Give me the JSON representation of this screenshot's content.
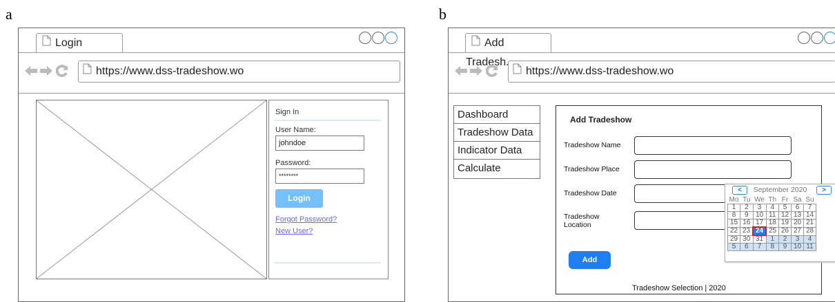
{
  "panel_a": {
    "letter": "a",
    "tab_title": "Login",
    "url": "https://www.dss-tradeshow.wo",
    "signin": {
      "heading": "Sign In",
      "username_label": "User Name:",
      "username_value": "johndoe",
      "password_label": "Password:",
      "password_value": "********",
      "login_button": "Login",
      "forgot_link": "Forgot Password?",
      "new_user_link": "New User?"
    }
  },
  "panel_b": {
    "letter": "b",
    "tab_title": "Add Tradesh..",
    "url": "https://www.dss-tradeshow.wo",
    "menu": [
      "Dashboard",
      "Tradeshow Data",
      "Indicator Data",
      "Calculate"
    ],
    "form": {
      "title": "Add Tradeshow",
      "name_label": "Tradeshow Name",
      "place_label": "Tradeshow Place",
      "date_label": "Tradeshow Date",
      "location_label_1": "Tradeshow",
      "location_label_2": "Location",
      "add_button": "Add"
    },
    "calendar": {
      "month_label": "September 2020",
      "prev": "<",
      "next": ">",
      "weekdays": [
        "Mo",
        "Tu",
        "We",
        "Th",
        "Fr",
        "Sa",
        "Su"
      ],
      "weeks": [
        [
          "1",
          "2",
          "3",
          "4",
          "5",
          "6",
          "7"
        ],
        [
          "8",
          "9",
          "10",
          "11",
          "12",
          "13",
          "14"
        ],
        [
          "15",
          "16",
          "17",
          "18",
          "19",
          "20",
          "21"
        ],
        [
          "22",
          "23",
          "24",
          "25",
          "26",
          "27",
          "28"
        ],
        [
          "29",
          "30",
          "31",
          "1",
          "2",
          "3",
          "4"
        ],
        [
          "5",
          "6",
          "7",
          "8",
          "9",
          "10",
          "11"
        ]
      ],
      "selected": "24"
    },
    "footer": "Tradeshow Selection | 2020"
  },
  "colors": {
    "accent": "#1f7ff0",
    "login_button": "#74c0fb",
    "link": "#6a6aee",
    "selected_border": "#e02020"
  }
}
